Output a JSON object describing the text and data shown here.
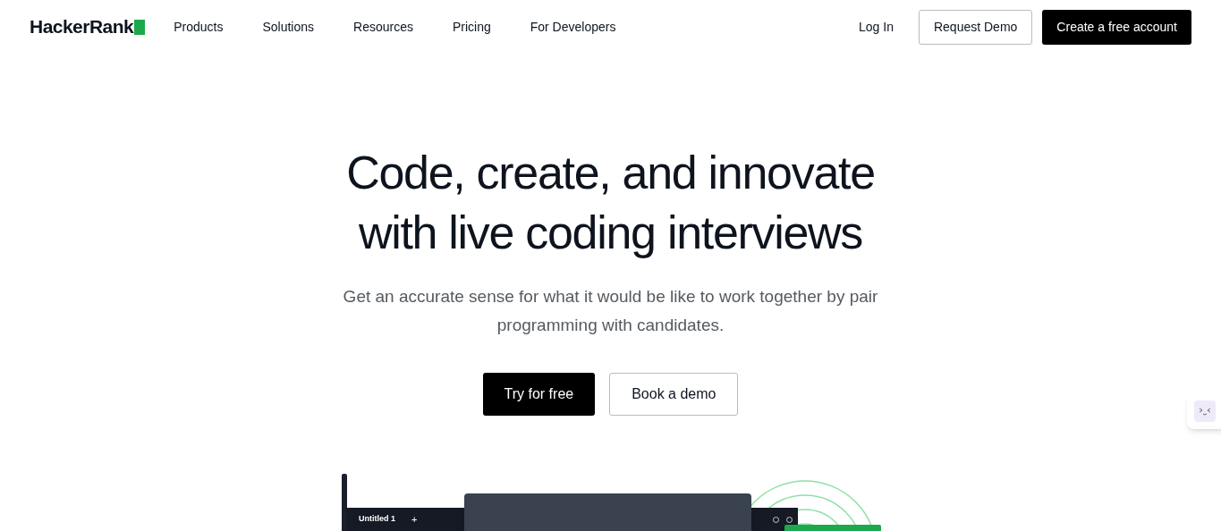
{
  "header": {
    "logo": "HackerRank",
    "nav": [
      "Products",
      "Solutions",
      "Resources",
      "Pricing",
      "For Developers"
    ],
    "login": "Log In",
    "request_demo": "Request Demo",
    "create_account": "Create a free account"
  },
  "hero": {
    "title_lines": [
      "Code, create, and innovate",
      "with live coding interviews"
    ],
    "subtitle": "Get an accurate sense for what it would be like to work together by pair programming with candidates.",
    "primary": "Try for free",
    "secondary": "Book a demo"
  },
  "editor": {
    "tab": "Untitled 1",
    "add": "+"
  }
}
